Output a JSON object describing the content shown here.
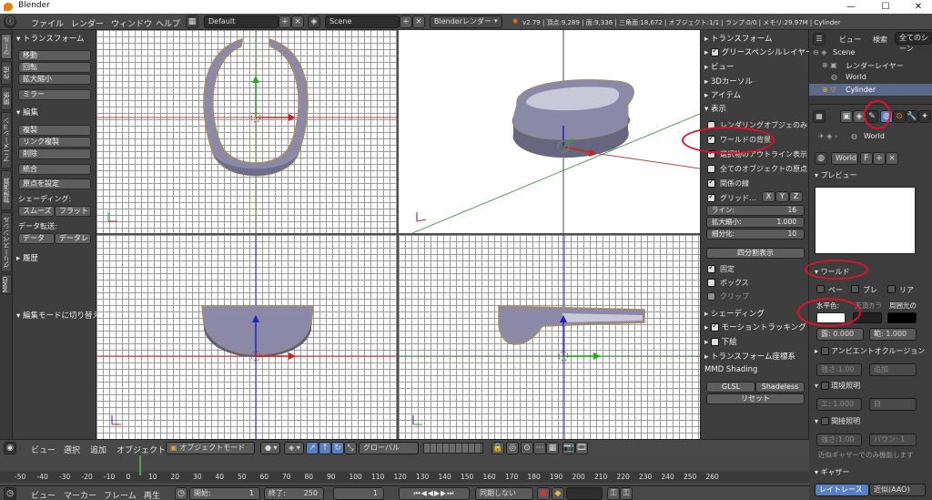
{
  "window": {
    "title": "Blender",
    "controls": [
      "—",
      "☐",
      "✕"
    ]
  },
  "menubar": {
    "info": "ⓘ",
    "items": [
      "ファイル",
      "レンダー",
      "ウィンドウ",
      "ヘルプ"
    ],
    "layout": "Default",
    "scene": "Scene",
    "engine": "Blenderレンダー",
    "stats": "v2.79 | 頂点:9,289 | 面:9,336 | 三角面:18,672 | オブジェクト:1/1 | ランプ:0/0 | メモリ:29.97M | Cylinder"
  },
  "vtabs": [
    "ツール",
    "作成",
    "関係",
    "アニメーション",
    "物理演算",
    "グリースペンシル",
    "MMD"
  ],
  "toolshelf": {
    "transform_header": "トランスフォーム",
    "transform_btns": [
      "移動",
      "回転",
      "拡大縮小"
    ],
    "mirror": "ミラー",
    "edit_header": "編集",
    "edit_btns": [
      "複製",
      "リンク複製",
      "削除"
    ],
    "join": "統合",
    "origin": "原点を設定",
    "shading_label": "シェーディング:",
    "smooth": "スムーズ",
    "flat": "フラット",
    "data_label": "データ転送:",
    "data": "データ",
    "data_layout": "データレ",
    "history": "履歴",
    "op": "編集モードに切り替え"
  },
  "npanel": {
    "transform": "トランスフォーム",
    "gpencil": "グリースペンシルレイヤー",
    "view": "ビュー",
    "cursor": "3Dカーソル",
    "item": "アイテム",
    "display": "表示",
    "d_opts": [
      {
        "label": "レンダリングオブジェのみ",
        "on": false
      },
      {
        "label": "ワールドの背景",
        "on": true
      },
      {
        "label": "選択物のアウトライン表示",
        "on": true
      },
      {
        "label": "全てのオブジェクトの原点",
        "on": false
      },
      {
        "label": "関係の線",
        "on": true
      }
    ],
    "grid_floor": "グリッド…",
    "axes": [
      "X",
      "Y",
      "Z"
    ],
    "lines": {
      "label": "ライン:",
      "value": "16"
    },
    "scale": {
      "label": "拡大縮小:",
      "value": "1.000"
    },
    "subdiv": {
      "label": "細分化:",
      "value": "10"
    },
    "quad": "四分割表示",
    "lock": "固定",
    "box": "ボックス",
    "clip": "クリップ",
    "shading": "シェーディング",
    "motion": "モーショントラッキング",
    "bg": "下絵",
    "orient": "トランスフォーム座標系",
    "mmd": "MMD Shading",
    "glsl": "GLSL",
    "shadeless": "Shadeless",
    "reset": "リセット"
  },
  "outliner": {
    "tabs": [
      "ビュー",
      "検索",
      "全てのシーン"
    ],
    "items": [
      "Scene",
      "レンダーレイヤー",
      "World",
      "Cylinder"
    ]
  },
  "props": {
    "world_label": "World",
    "world_field": "World",
    "f": "F",
    "preview": "プレビュー",
    "world_panel": "ワールド",
    "cbs": [
      "ペー",
      "ブレ",
      "リア"
    ],
    "horizon": "水平色:",
    "zenith": "天頂カラ",
    "ambient": "周囲光の",
    "exp": "露: 0.000",
    "range": "範: 1.000",
    "ao": "アンビエントオクルージョン",
    "ao_str": "強さ:1.00",
    "ao_mode": "追加",
    "env": "環境照明",
    "env_e": "エ: 1.000",
    "env_c": "白",
    "indirect": "間接照明",
    "ind_s": "強さ:1.00",
    "ind_b": "バウン: 1",
    "approx": "近似ギャザーでのみ機能します",
    "gather": "ギャザー",
    "raytrace": "レイトレース",
    "approx_tab": "近似(AAO)"
  },
  "vpheader": {
    "menus": [
      "ビュー",
      "選択",
      "追加",
      "オブジェクト"
    ],
    "mode": "オブジェクトモード",
    "orient": "グローバル"
  },
  "timeline": {
    "ticks": [
      "-50",
      "-40",
      "-30",
      "-20",
      "-10",
      "0",
      "10",
      "20",
      "30",
      "40",
      "50",
      "60",
      "70",
      "80",
      "90",
      "100",
      "110",
      "120",
      "130",
      "140",
      "150",
      "160",
      "170",
      "180",
      "190",
      "200",
      "210",
      "220",
      "230",
      "240",
      "250",
      "260"
    ]
  },
  "footer": {
    "menus": [
      "ビュー",
      "マーカー",
      "フレーム",
      "再生"
    ],
    "start": "開始:",
    "start_v": "1",
    "end": "終了:",
    "end_v": "250",
    "cur": "1",
    "sync": "同期しない"
  }
}
